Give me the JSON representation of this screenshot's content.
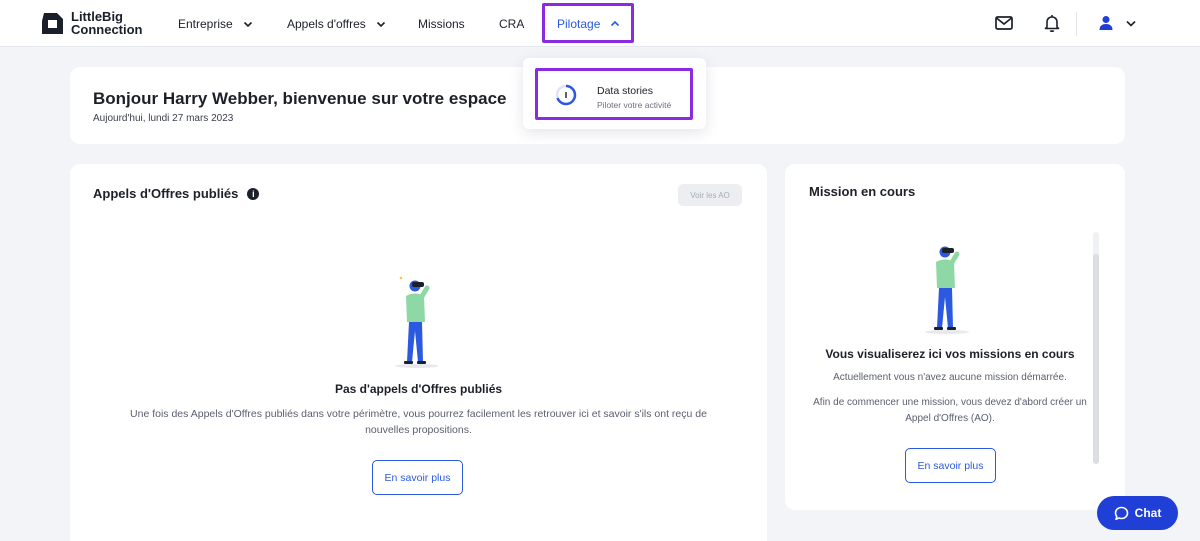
{
  "brand": {
    "line1": "LittleBig",
    "line2": "Connection"
  },
  "nav": {
    "entreprise": "Entreprise",
    "appels": "Appels d'offres",
    "missions": "Missions",
    "cra": "CRA",
    "pilotage": "Pilotage"
  },
  "dropdown": {
    "title": "Data stories",
    "subtitle": "Piloter votre activité"
  },
  "welcome": {
    "title": "Bonjour Harry Webber, bienvenue sur votre espace",
    "date": "Aujourd'hui, lundi 27 mars 2023"
  },
  "ao": {
    "title": "Appels d'Offres publiés",
    "info": "i",
    "voir_label": "Voir les AO",
    "empty_title": "Pas d'appels d'Offres publiés",
    "empty_text": "Une fois des Appels d'Offres publiés dans votre périmètre, vous pourrez facilement les retrouver ici et savoir s'ils ont reçu de nouvelles propositions.",
    "button": "En savoir plus"
  },
  "mission": {
    "title": "Mission en cours",
    "empty_title": "Vous visualiserez ici vos missions en cours",
    "text1": "Actuellement vous n'avez aucune mission démarrée.",
    "text2": "Afin de commencer une mission, vous devez d'abord créer un Appel d'Offres (AO).",
    "button": "En savoir plus"
  },
  "chat": {
    "label": "Chat"
  },
  "colors": {
    "accent": "#2b59e0",
    "highlight": "#8a2be2",
    "chat": "#1f3fd6"
  }
}
